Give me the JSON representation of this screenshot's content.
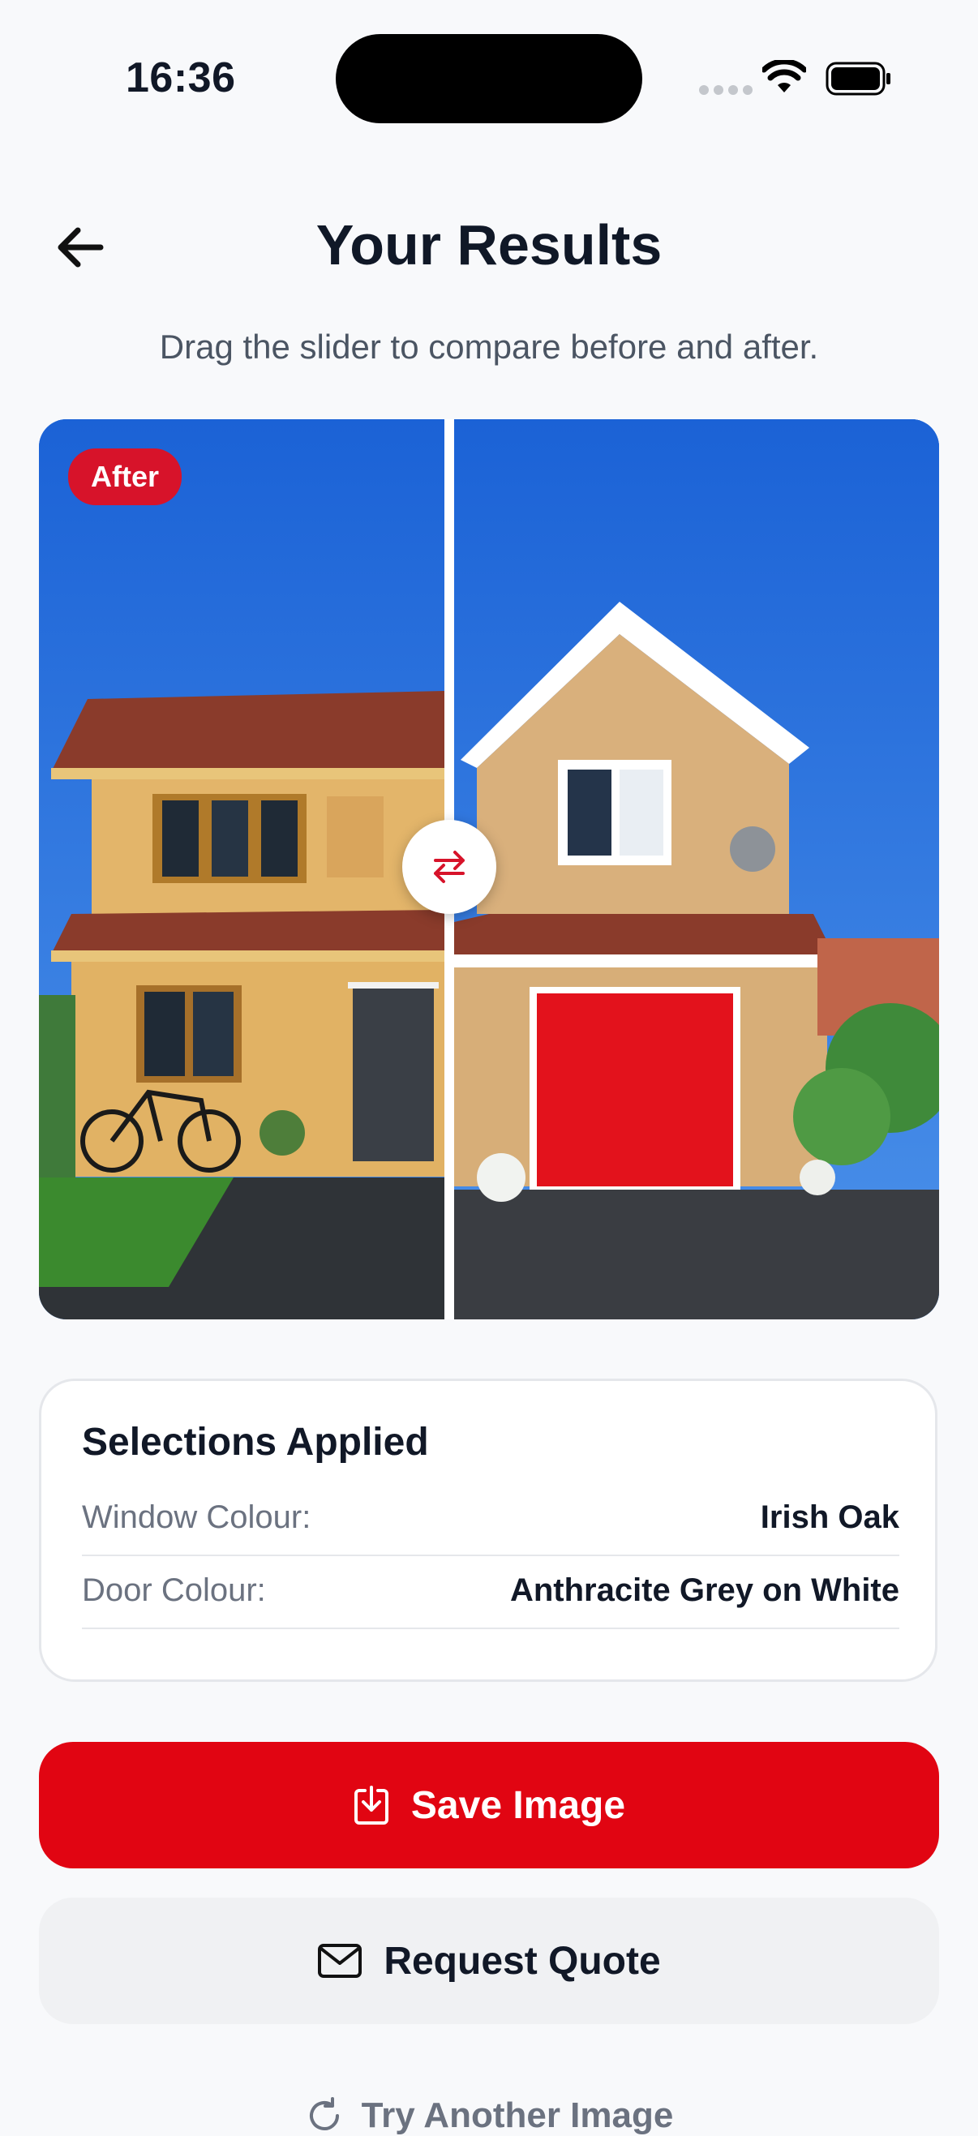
{
  "status_bar": {
    "time": "16:36"
  },
  "header": {
    "title": "Your Results",
    "back_icon": "arrow-left-icon",
    "subtitle": "Drag the slider to compare before and after."
  },
  "comparison": {
    "badge": "After",
    "slider_position_percent": 46,
    "slider_icon": "swap-arrows-icon",
    "accent_color": "#d7132a"
  },
  "selections": {
    "title": "Selections Applied",
    "items": [
      {
        "label": "Window Colour:",
        "value": "Irish Oak"
      },
      {
        "label": "Door Colour:",
        "value": "Anthracite Grey on White"
      }
    ]
  },
  "actions": {
    "save_label": "Save Image",
    "save_icon": "download-icon",
    "quote_label": "Request Quote",
    "quote_icon": "mail-icon",
    "try_label": "Try Another Image",
    "try_icon": "refresh-icon",
    "primary_color": "#e10512"
  }
}
